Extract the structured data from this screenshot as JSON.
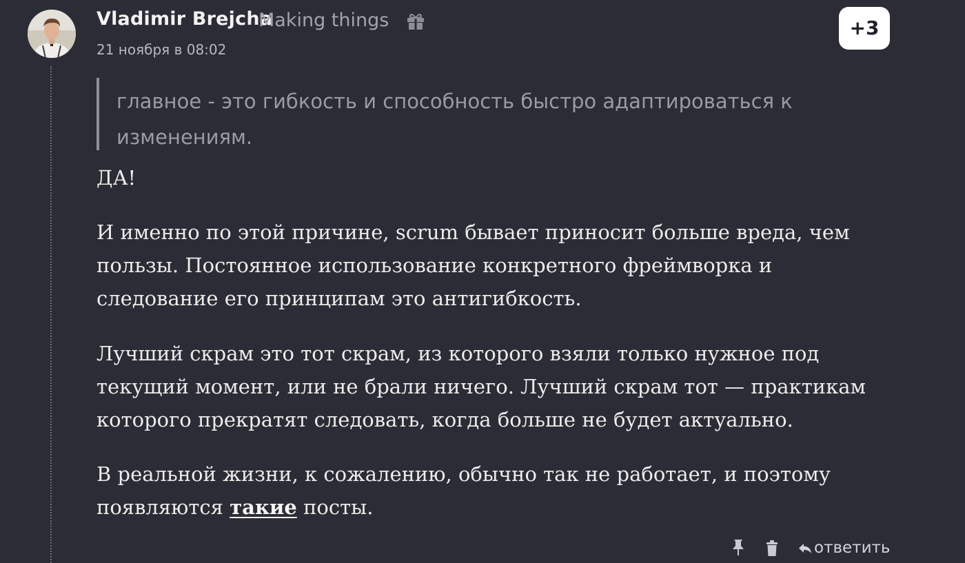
{
  "comment": {
    "author": "Vladimir Brejcha",
    "tagline": "Making things",
    "timestamp": "21 ноября в 08:02",
    "score": "+3",
    "quote": "главное - это гибкость и способность быстро адаптироваться к изменениям.",
    "paragraphs": [
      "ДА!",
      "И именно по этой причине, scrum бывает приносит больше вреда, чем пользы. Постоянное использование конкретного фреймворка и следование его принципам это антигибкость.",
      "Лучший скрам это тот скрам, из которого взяли только нужное под текущий момент, или не брали ничего. Лучший скрам тот — практикам которого прекратят следовать, когда больше не будет актуально."
    ],
    "last_paragraph": {
      "before": "В реальной жизни, к сожалению, обычно так не работает, и поэтому появляются ",
      "link": "такие",
      "after": " посты."
    },
    "actions": {
      "reply_label": "ответить"
    }
  },
  "icons": {
    "gift": "gift-icon",
    "pin": "pin-icon",
    "trash": "trash-icon",
    "reply": "reply-arrow-icon"
  },
  "colors": {
    "background": "#2b2c35",
    "text": "#ececec",
    "muted": "#a3a4ab",
    "score_badge_bg": "#ffffff"
  }
}
